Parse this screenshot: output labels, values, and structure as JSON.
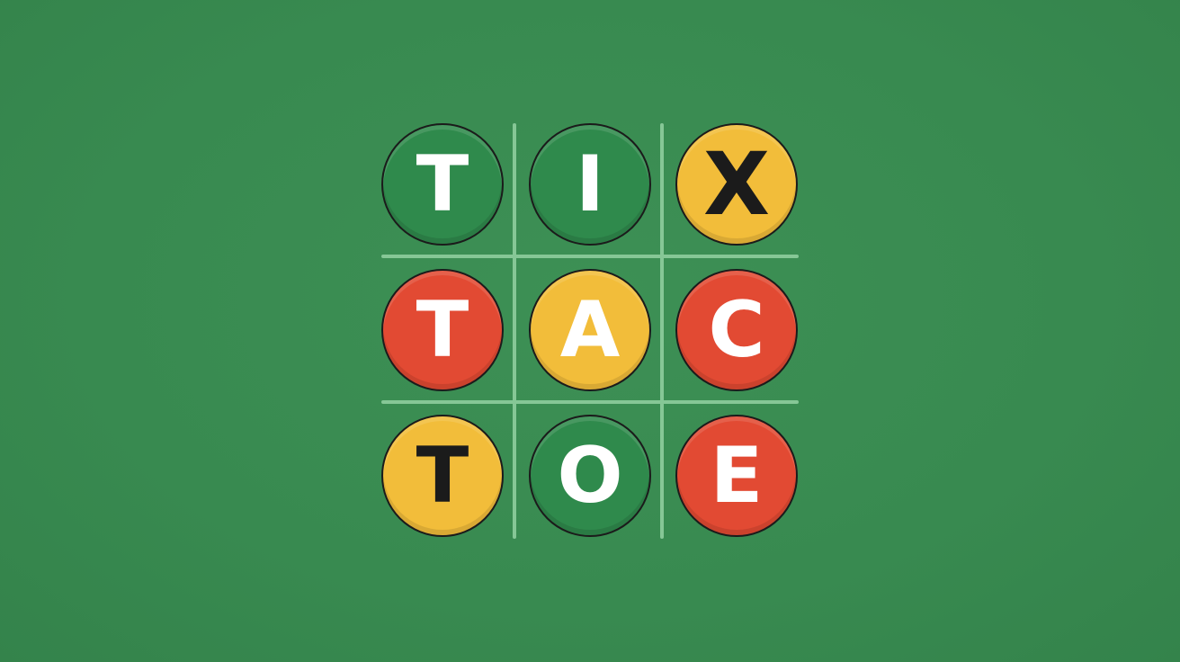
{
  "palette": {
    "background": "#388a50",
    "grid": "#86c796",
    "green": "#2f8a4c",
    "yellow": "#f2bd3a",
    "red": "#e24a33",
    "white": "#ffffff",
    "black": "#1b1b1b"
  },
  "board": {
    "cells": [
      {
        "letter": "T",
        "fill": "#2f8a4c",
        "ink": "#ffffff"
      },
      {
        "letter": "I",
        "fill": "#2f8a4c",
        "ink": "#ffffff"
      },
      {
        "letter": "X",
        "fill": "#f2bd3a",
        "ink": "#1b1b1b"
      },
      {
        "letter": "T",
        "fill": "#e24a33",
        "ink": "#ffffff"
      },
      {
        "letter": "A",
        "fill": "#f2bd3a",
        "ink": "#ffffff"
      },
      {
        "letter": "C",
        "fill": "#e24a33",
        "ink": "#ffffff"
      },
      {
        "letter": "T",
        "fill": "#f2bd3a",
        "ink": "#1b1b1b"
      },
      {
        "letter": "O",
        "fill": "#2f8a4c",
        "ink": "#ffffff"
      },
      {
        "letter": "E",
        "fill": "#e24a33",
        "ink": "#ffffff"
      }
    ]
  }
}
